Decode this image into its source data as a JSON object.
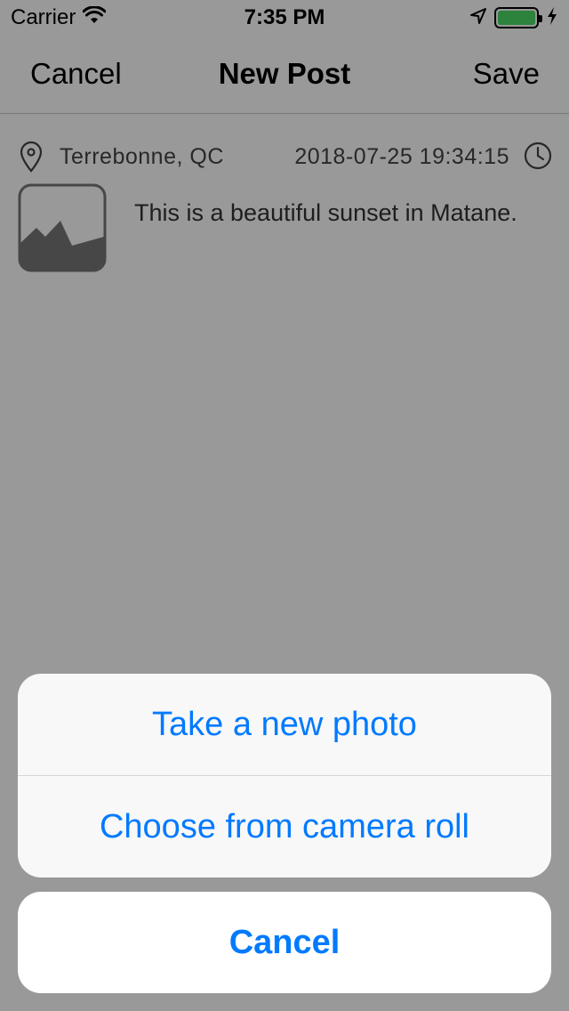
{
  "status_bar": {
    "carrier": "Carrier",
    "time": "7:35 PM",
    "battery_level": 1.0,
    "battery_color": "#4cd964"
  },
  "nav": {
    "left_label": "Cancel",
    "title": "New Post",
    "right_label": "Save"
  },
  "post": {
    "location": "Terrebonne, QC",
    "datetime": "2018-07-25 19:34:15",
    "text": "This is a beautiful sunset in Matane.",
    "icons": [
      "map-pin-icon",
      "clock-icon",
      "image-placeholder-icon"
    ]
  },
  "action_sheet": {
    "options": [
      "Take a new photo",
      "Choose from camera roll"
    ],
    "cancel_label": "Cancel",
    "accent_color": "#007aff"
  }
}
